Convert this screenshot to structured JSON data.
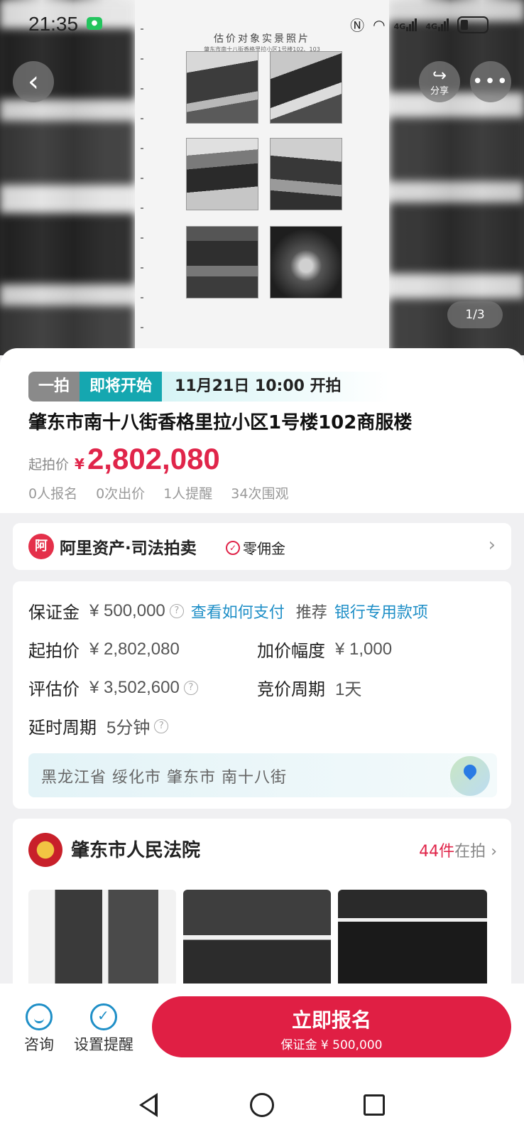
{
  "status_bar": {
    "time": "21:35",
    "app_badge": "WeChat",
    "network": "4G"
  },
  "hero": {
    "doc_title": "估价对象实景照片",
    "doc_subtitle": "肇东市南十八街香格里拉小区1号楼102、103",
    "share_label": "分享",
    "pager": "1/3"
  },
  "auction": {
    "round_tag": "一拍",
    "status_tag": "即将开始",
    "start_time": "11月21日 10:00 开拍",
    "title": "肇东市南十八街香格里拉小区1号楼102商服楼",
    "start_price_label": "起拍价",
    "currency": "¥",
    "start_price": "2,802,080",
    "stats": [
      "0人报名",
      "0次出价",
      "1人提醒",
      "34次围观"
    ]
  },
  "platform": {
    "logo_char": "阿",
    "name": "阿里资产·司法拍卖",
    "badge": "零佣金"
  },
  "details": {
    "deposit_label": "保证金",
    "deposit": "¥ 500,000",
    "how_to_pay": "查看如何支付",
    "recommend_label": "推荐",
    "bank_link": "银行专用款项",
    "start_price_label": "起拍价",
    "start_price": "¥ 2,802,080",
    "increment_label": "加价幅度",
    "increment": "¥ 1,000",
    "appraisal_label": "评估价",
    "appraisal": "¥ 3,502,600",
    "cycle_label": "竞价周期",
    "cycle": "1天",
    "delay_label": "延时周期",
    "delay": "5分钟",
    "address": "黑龙江省 绥化市 肇东市 南十八街"
  },
  "court": {
    "name": "肇东市人民法院",
    "count": "44件",
    "count_suffix": "在拍"
  },
  "bottom_bar": {
    "consult_label": "咨询",
    "reminder_label": "设置提醒",
    "cta_label": "立即报名",
    "cta_sub": "保证金 ¥ 500,000"
  },
  "colors": {
    "accent": "#e01f44",
    "teal": "#15a7b0",
    "link": "#1f8fc7"
  }
}
